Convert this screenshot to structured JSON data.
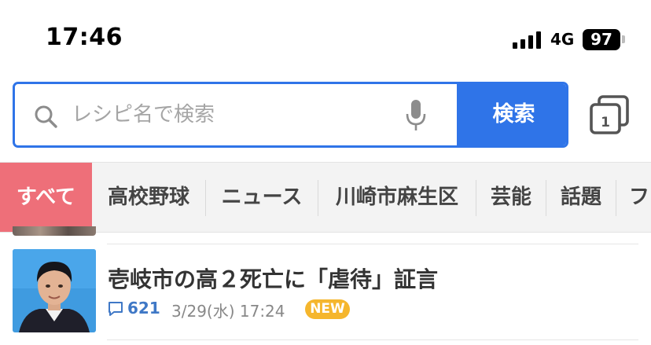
{
  "status_bar": {
    "time": "17:46",
    "network": "4G",
    "battery": "97"
  },
  "search": {
    "placeholder": "レシピ名で検索",
    "button_label": "検索",
    "accent_color": "#2f74e8"
  },
  "tab_switcher": {
    "count": "1"
  },
  "categories": [
    {
      "label": "すべて",
      "active": true
    },
    {
      "label": "高校野球",
      "active": false
    },
    {
      "label": "ニュース",
      "active": false
    },
    {
      "label": "川崎市麻生区",
      "active": false
    },
    {
      "label": "芸能",
      "active": false
    },
    {
      "label": "話題",
      "active": false
    },
    {
      "label": "フ",
      "active": false
    }
  ],
  "news": [
    {
      "title": "壱岐市の高２死亡に「虐待」証言",
      "comments": "621",
      "date": "3/29(水) 17:24",
      "badge": "NEW"
    }
  ]
}
